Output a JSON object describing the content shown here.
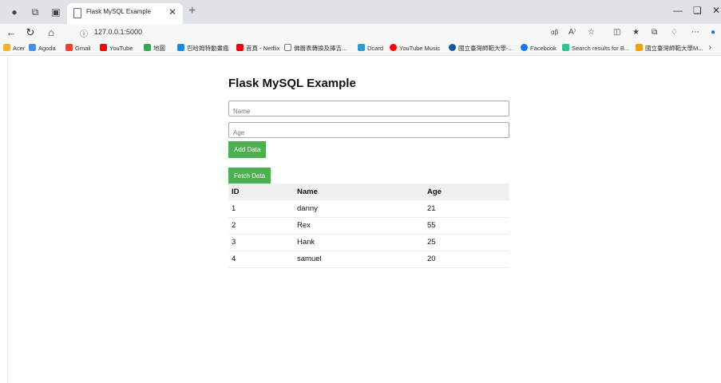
{
  "browser": {
    "tab_title": "Flask MySQL Example",
    "url": "127.0.0.1:5000",
    "bookmarks": [
      {
        "label": "Acer",
        "color": "#f2b233"
      },
      {
        "label": "Agoda",
        "color": "#4a90e2"
      },
      {
        "label": "Gmail",
        "color": "#ea4335"
      },
      {
        "label": "YouTube",
        "color": "#ff0000"
      },
      {
        "label": "地圖",
        "color": "#34a853"
      },
      {
        "label": "巴哈姆特動畫瘋",
        "color": "#1c8ad8"
      },
      {
        "label": "首頁 - Netflix",
        "color": "#e50914"
      },
      {
        "label": "佛曆表轉換及擇吉...",
        "color": "#777777"
      },
      {
        "label": "Dcard",
        "color": "#3397cf"
      },
      {
        "label": "YouTube Music",
        "color": "#ff0000"
      },
      {
        "label": "國立臺灣師範大學-...",
        "color": "#1a5599"
      },
      {
        "label": "Facebook",
        "color": "#1877f2"
      },
      {
        "label": "Search results for B...",
        "color": "#34c38f"
      },
      {
        "label": "國立臺灣師範大學M...",
        "color": "#e8a317"
      }
    ]
  },
  "page": {
    "title": "Flask MySQL Example",
    "name_placeholder": "Name",
    "age_placeholder": "Age",
    "add_button": "Add Data",
    "fetch_button": "Fetch Data",
    "table": {
      "headers": [
        "ID",
        "Name",
        "Age"
      ],
      "rows": [
        [
          "1",
          "danny",
          "21"
        ],
        [
          "2",
          "Rex",
          "55"
        ],
        [
          "3",
          "Hank",
          "25"
        ],
        [
          "4",
          "samuel",
          "20"
        ]
      ]
    }
  },
  "colors": {
    "accent": "#4caf50"
  }
}
